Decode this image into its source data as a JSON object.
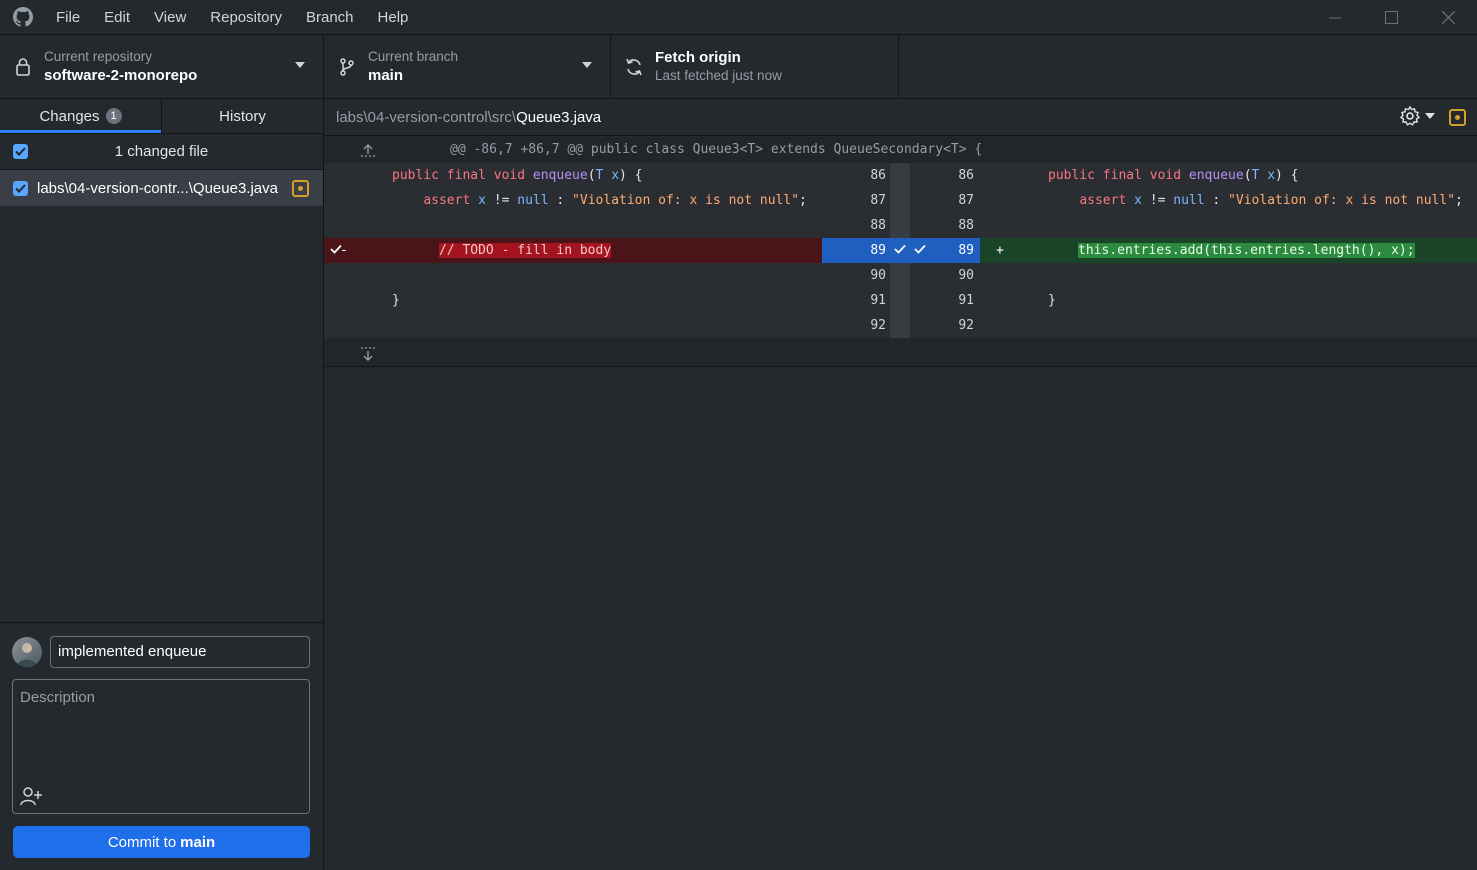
{
  "menu": {
    "items": [
      "File",
      "Edit",
      "View",
      "Repository",
      "Branch",
      "Help"
    ]
  },
  "toolbar": {
    "repo_label": "Current repository",
    "repo_value": "software-2-monorepo",
    "branch_label": "Current branch",
    "branch_value": "main",
    "fetch_label": "Fetch origin",
    "fetch_sub": "Last fetched just now"
  },
  "sidebar": {
    "tabs": [
      {
        "label": "Changes",
        "count": "1"
      },
      {
        "label": "History"
      }
    ],
    "changes_header": "1 changed file",
    "files": [
      {
        "name": "labs\\04-version-contr...\\Queue3.java",
        "status": "modified"
      }
    ]
  },
  "commit": {
    "summary": "implemented enqueue",
    "description_placeholder": "Description",
    "button_prefix": "Commit to",
    "button_branch": "main"
  },
  "diff": {
    "path_dir": "labs\\04-version-control\\src\\",
    "path_file": "Queue3.java",
    "hunk_header": "@@ -86,7 +86,7 @@ public class Queue3<T> extends QueueSecondary<T> {",
    "rows": [
      {
        "left_no": "86",
        "right_no": "86"
      },
      {
        "left_no": "87",
        "right_no": "87"
      },
      {
        "left_no": "88",
        "right_no": "88"
      },
      {
        "left_no": "89",
        "right_no": "89",
        "left_marker": "-",
        "right_marker": "+",
        "left_text": "// TODO - fill in body",
        "right_text": "this.entries.add(this.entries.length(), x);"
      },
      {
        "left_no": "90",
        "right_no": "90"
      },
      {
        "left_no": "91",
        "right_no": "91",
        "left_text": "}",
        "right_text": "}"
      },
      {
        "left_no": "92",
        "right_no": "92"
      }
    ],
    "code": {
      "kw_public": "public",
      "kw_final": "final",
      "kw_void": "void",
      "fn_enqueue": "enqueue",
      "paren_open": "(",
      "ty_T": "T",
      "var_x": "x",
      "sig_end": ") {",
      "kw_assert": "assert",
      "neq": "!=",
      "kw_null": "null",
      "colon": ":",
      "msg": "\"Violation of: x is not null\"",
      "semi": ";"
    }
  },
  "colors": {
    "accent": "#1f6feb",
    "deleted": "#4a1418",
    "added": "#1a4427",
    "modified": "#d3a02c"
  }
}
